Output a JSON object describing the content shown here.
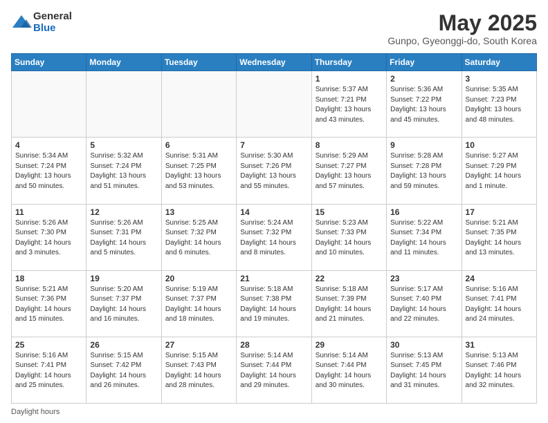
{
  "header": {
    "logo_general": "General",
    "logo_blue": "Blue",
    "title": "May 2025",
    "subtitle": "Gunpo, Gyeonggi-do, South Korea"
  },
  "footer": {
    "label": "Daylight hours"
  },
  "weekdays": [
    "Sunday",
    "Monday",
    "Tuesday",
    "Wednesday",
    "Thursday",
    "Friday",
    "Saturday"
  ],
  "weeks": [
    [
      {
        "day": "",
        "info": ""
      },
      {
        "day": "",
        "info": ""
      },
      {
        "day": "",
        "info": ""
      },
      {
        "day": "",
        "info": ""
      },
      {
        "day": "1",
        "info": "Sunrise: 5:37 AM\nSunset: 7:21 PM\nDaylight: 13 hours\nand 43 minutes."
      },
      {
        "day": "2",
        "info": "Sunrise: 5:36 AM\nSunset: 7:22 PM\nDaylight: 13 hours\nand 45 minutes."
      },
      {
        "day": "3",
        "info": "Sunrise: 5:35 AM\nSunset: 7:23 PM\nDaylight: 13 hours\nand 48 minutes."
      }
    ],
    [
      {
        "day": "4",
        "info": "Sunrise: 5:34 AM\nSunset: 7:24 PM\nDaylight: 13 hours\nand 50 minutes."
      },
      {
        "day": "5",
        "info": "Sunrise: 5:32 AM\nSunset: 7:24 PM\nDaylight: 13 hours\nand 51 minutes."
      },
      {
        "day": "6",
        "info": "Sunrise: 5:31 AM\nSunset: 7:25 PM\nDaylight: 13 hours\nand 53 minutes."
      },
      {
        "day": "7",
        "info": "Sunrise: 5:30 AM\nSunset: 7:26 PM\nDaylight: 13 hours\nand 55 minutes."
      },
      {
        "day": "8",
        "info": "Sunrise: 5:29 AM\nSunset: 7:27 PM\nDaylight: 13 hours\nand 57 minutes."
      },
      {
        "day": "9",
        "info": "Sunrise: 5:28 AM\nSunset: 7:28 PM\nDaylight: 13 hours\nand 59 minutes."
      },
      {
        "day": "10",
        "info": "Sunrise: 5:27 AM\nSunset: 7:29 PM\nDaylight: 14 hours\nand 1 minute."
      }
    ],
    [
      {
        "day": "11",
        "info": "Sunrise: 5:26 AM\nSunset: 7:30 PM\nDaylight: 14 hours\nand 3 minutes."
      },
      {
        "day": "12",
        "info": "Sunrise: 5:26 AM\nSunset: 7:31 PM\nDaylight: 14 hours\nand 5 minutes."
      },
      {
        "day": "13",
        "info": "Sunrise: 5:25 AM\nSunset: 7:32 PM\nDaylight: 14 hours\nand 6 minutes."
      },
      {
        "day": "14",
        "info": "Sunrise: 5:24 AM\nSunset: 7:32 PM\nDaylight: 14 hours\nand 8 minutes."
      },
      {
        "day": "15",
        "info": "Sunrise: 5:23 AM\nSunset: 7:33 PM\nDaylight: 14 hours\nand 10 minutes."
      },
      {
        "day": "16",
        "info": "Sunrise: 5:22 AM\nSunset: 7:34 PM\nDaylight: 14 hours\nand 11 minutes."
      },
      {
        "day": "17",
        "info": "Sunrise: 5:21 AM\nSunset: 7:35 PM\nDaylight: 14 hours\nand 13 minutes."
      }
    ],
    [
      {
        "day": "18",
        "info": "Sunrise: 5:21 AM\nSunset: 7:36 PM\nDaylight: 14 hours\nand 15 minutes."
      },
      {
        "day": "19",
        "info": "Sunrise: 5:20 AM\nSunset: 7:37 PM\nDaylight: 14 hours\nand 16 minutes."
      },
      {
        "day": "20",
        "info": "Sunrise: 5:19 AM\nSunset: 7:37 PM\nDaylight: 14 hours\nand 18 minutes."
      },
      {
        "day": "21",
        "info": "Sunrise: 5:18 AM\nSunset: 7:38 PM\nDaylight: 14 hours\nand 19 minutes."
      },
      {
        "day": "22",
        "info": "Sunrise: 5:18 AM\nSunset: 7:39 PM\nDaylight: 14 hours\nand 21 minutes."
      },
      {
        "day": "23",
        "info": "Sunrise: 5:17 AM\nSunset: 7:40 PM\nDaylight: 14 hours\nand 22 minutes."
      },
      {
        "day": "24",
        "info": "Sunrise: 5:16 AM\nSunset: 7:41 PM\nDaylight: 14 hours\nand 24 minutes."
      }
    ],
    [
      {
        "day": "25",
        "info": "Sunrise: 5:16 AM\nSunset: 7:41 PM\nDaylight: 14 hours\nand 25 minutes."
      },
      {
        "day": "26",
        "info": "Sunrise: 5:15 AM\nSunset: 7:42 PM\nDaylight: 14 hours\nand 26 minutes."
      },
      {
        "day": "27",
        "info": "Sunrise: 5:15 AM\nSunset: 7:43 PM\nDaylight: 14 hours\nand 28 minutes."
      },
      {
        "day": "28",
        "info": "Sunrise: 5:14 AM\nSunset: 7:44 PM\nDaylight: 14 hours\nand 29 minutes."
      },
      {
        "day": "29",
        "info": "Sunrise: 5:14 AM\nSunset: 7:44 PM\nDaylight: 14 hours\nand 30 minutes."
      },
      {
        "day": "30",
        "info": "Sunrise: 5:13 AM\nSunset: 7:45 PM\nDaylight: 14 hours\nand 31 minutes."
      },
      {
        "day": "31",
        "info": "Sunrise: 5:13 AM\nSunset: 7:46 PM\nDaylight: 14 hours\nand 32 minutes."
      }
    ]
  ]
}
